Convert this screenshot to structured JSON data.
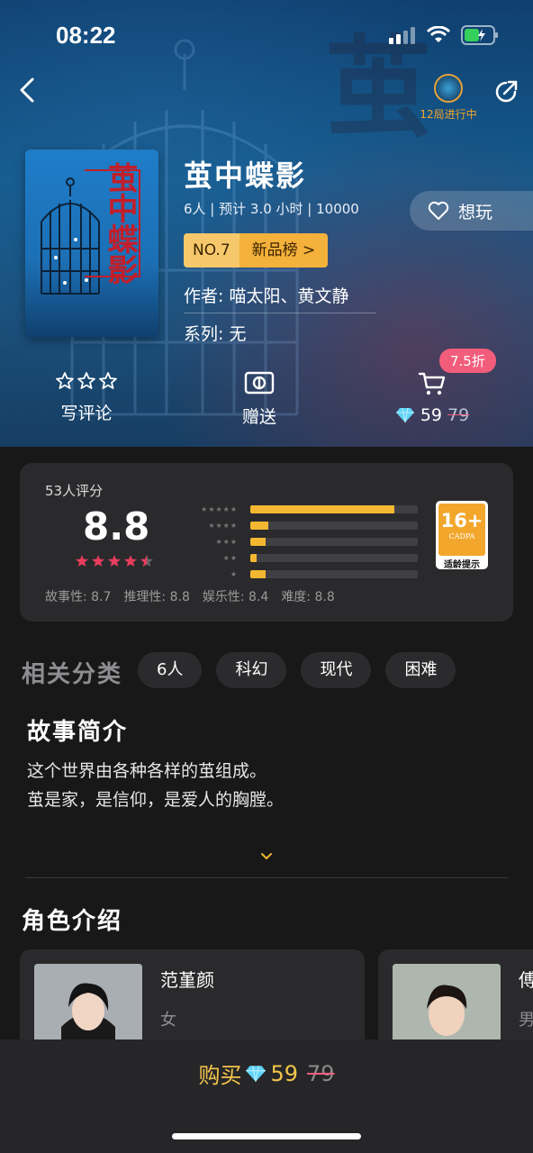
{
  "status": {
    "time": "08:22"
  },
  "colors": {
    "accent": "#f4b731",
    "pink": "#f25d7c",
    "star_red": "#ea3d5e",
    "background": "#181818"
  },
  "header": {
    "live_text": "12局进行中",
    "icons": [
      "back-icon",
      "share-icon"
    ]
  },
  "game": {
    "title": "茧中蝶影",
    "meta": "6人 | 预计 3.0 小时 | 10000",
    "rank_no": "NO.7",
    "rank_label": "新品榜 >",
    "author": "作者: 喵太阳、黄文静",
    "series": "系列: 无",
    "cover_title": "茧中蝶影",
    "want_label": "想玩"
  },
  "actions": {
    "review_label": "写评论",
    "gift_label": "赠送",
    "discount": "7.5折",
    "price": "59",
    "old_price": "79"
  },
  "rating": {
    "count_label": "53人评分",
    "score": "8.8",
    "stars": 4.5,
    "distribution": [
      {
        "stars": 5,
        "fraction": 0.86
      },
      {
        "stars": 4,
        "fraction": 0.11
      },
      {
        "stars": 3,
        "fraction": 0.09
      },
      {
        "stars": 2,
        "fraction": 0.04
      },
      {
        "stars": 1,
        "fraction": 0.09
      }
    ],
    "age_number": "16+",
    "age_org": "CADPA",
    "age_tip": "适龄提示",
    "sub_scores": [
      "故事性: 8.7",
      "推理性: 8.8",
      "娱乐性: 8.4",
      "难度: 8.8"
    ]
  },
  "categories": {
    "title": "相关分类",
    "tags": [
      "6人",
      "科幻",
      "现代",
      "困难"
    ]
  },
  "intro": {
    "title": "故事简介",
    "lines": [
      "这个世界由各种各样的茧组成。",
      "茧是家，是信仰，是爱人的胸膛。"
    ]
  },
  "roles": {
    "title": "角色介绍",
    "items": [
      {
        "name": "范堇颜",
        "gender": "女"
      },
      {
        "name": "傅",
        "gender": "男"
      }
    ]
  },
  "bottom": {
    "buy_label": "购买",
    "price": "59",
    "old_price": "79"
  }
}
